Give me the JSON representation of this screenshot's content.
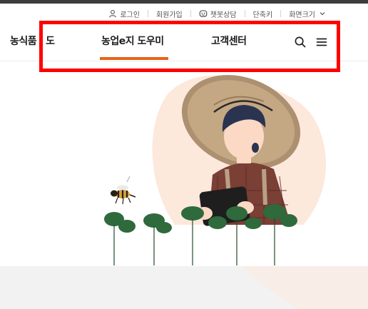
{
  "utility": {
    "login": "로그인",
    "signup": "회원가입",
    "chatbot": "챗봇상담",
    "shortcut": "단축키",
    "zoom": "화면크기"
  },
  "header": {
    "brand": "농식품",
    "brand_suffix": "도",
    "tabs": [
      {
        "label": "농업e지 도우미",
        "active": true
      },
      {
        "label": "고객센터",
        "active": false
      }
    ]
  },
  "icons": {
    "login": "user-icon",
    "chatbot": "chatbot-icon",
    "zoom": "chevron-down-icon",
    "search": "search-icon",
    "menu": "hamburger-menu-icon"
  },
  "colors": {
    "accent": "#e8621a",
    "highlight": "#ff0000"
  }
}
